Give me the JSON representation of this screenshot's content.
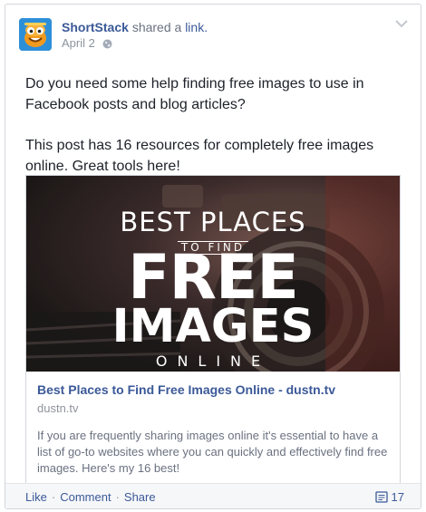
{
  "post": {
    "author": "ShortStack",
    "action_verb": "shared a",
    "action_object": "link.",
    "date": "April 2",
    "paragraphs": [
      "Do you need some help finding free images to use in Facebook posts and blog articles?",
      "This post has 16 resources for completely free images online. Great tools here!"
    ]
  },
  "attachment": {
    "image_text": {
      "line1": "BEST PLACES",
      "line2": "TO FIND",
      "line3": "FREE",
      "line4": "IMAGES",
      "line5": "ONLINE"
    },
    "title": "Best Places to Find Free Images Online - dustn.tv",
    "domain": "dustn.tv",
    "description": "If you are frequently sharing images online it's essential to have a list of go-to websites where you can quickly and effectively find free images. Here's my 16 best!"
  },
  "footer": {
    "like_label": "Like",
    "comment_label": "Comment",
    "share_label": "Share",
    "separator": "·",
    "comment_count": "17"
  },
  "colors": {
    "link_blue": "#3b5998",
    "muted_gray": "#90949c",
    "footer_bg": "#f6f7f9"
  }
}
